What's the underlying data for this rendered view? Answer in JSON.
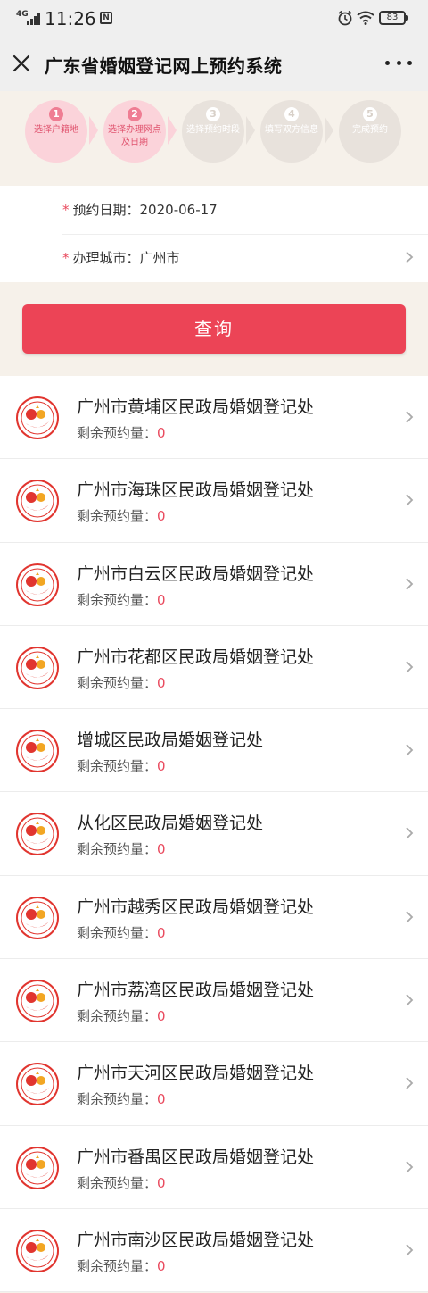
{
  "status_bar": {
    "network": "4G",
    "time": "11:26",
    "battery": "83"
  },
  "nav": {
    "title": "广东省婚姻登记网上预约系统"
  },
  "steps": [
    {
      "num": "1",
      "label": "选择户籍地",
      "active": true
    },
    {
      "num": "2",
      "label": "选择办理网点及日期",
      "active": true
    },
    {
      "num": "3",
      "label": "选择预约时段",
      "active": false
    },
    {
      "num": "4",
      "label": "填写双方信息",
      "active": false
    },
    {
      "num": "5",
      "label": "完成预约",
      "active": false
    }
  ],
  "form": {
    "date_label": "预约日期：",
    "date_value": "2020-06-17",
    "city_label": "办理城市：",
    "city_value": "广州市",
    "required_mark": "*"
  },
  "query_button": "查询",
  "quota_label": "剩余预约量：",
  "offices": [
    {
      "name": "广州市黄埔区民政局婚姻登记处",
      "quota": "0"
    },
    {
      "name": "广州市海珠区民政局婚姻登记处",
      "quota": "0"
    },
    {
      "name": "广州市白云区民政局婚姻登记处",
      "quota": "0"
    },
    {
      "name": "广州市花都区民政局婚姻登记处",
      "quota": "0"
    },
    {
      "name": "增城区民政局婚姻登记处",
      "quota": "0"
    },
    {
      "name": "从化区民政局婚姻登记处",
      "quota": "0"
    },
    {
      "name": "广州市越秀区民政局婚姻登记处",
      "quota": "0"
    },
    {
      "name": "广州市荔湾区民政局婚姻登记处",
      "quota": "0"
    },
    {
      "name": "广州市天河区民政局婚姻登记处",
      "quota": "0"
    },
    {
      "name": "广州市番禺区民政局婚姻登记处",
      "quota": "0"
    },
    {
      "name": "广州市南沙区民政局婚姻登记处",
      "quota": "0"
    }
  ],
  "colors": {
    "accent": "#ec4456",
    "step_active": "#fbd3da",
    "step_inactive": "#e8e2dc"
  }
}
